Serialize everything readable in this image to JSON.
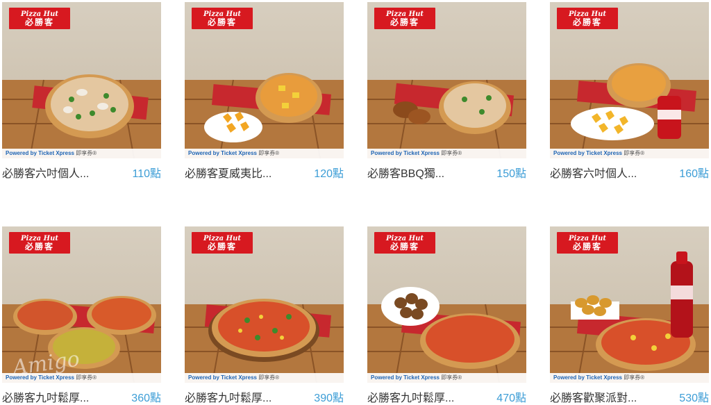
{
  "brand": {
    "logo_en": "Pizza Hut",
    "logo_zh": "必勝客"
  },
  "powered_by": {
    "text": "Powered by Ticket Xpress",
    "suffix": "即享券®"
  },
  "watermark": "Amigo",
  "products": [
    {
      "name": "必勝客六吋個人...",
      "price": "110點",
      "scene": "pizza1"
    },
    {
      "name": "必勝客夏威夷比...",
      "price": "120點",
      "scene": "pizza-bites"
    },
    {
      "name": "必勝客BBQ獨...",
      "price": "150點",
      "scene": "pizza-wings"
    },
    {
      "name": "必勝客六吋個人...",
      "price": "160點",
      "scene": "pizza-bites-coke"
    },
    {
      "name": "必勝客九吋鬆厚...",
      "price": "360點",
      "scene": "three-pizzas"
    },
    {
      "name": "必勝客九吋鬆厚...",
      "price": "390點",
      "scene": "big-pizza"
    },
    {
      "name": "必勝客九吋鬆厚...",
      "price": "470點",
      "scene": "pizza-drumlets"
    },
    {
      "name": "必勝客歡聚派對...",
      "price": "530點",
      "scene": "pizza-nuggets-coke"
    }
  ]
}
